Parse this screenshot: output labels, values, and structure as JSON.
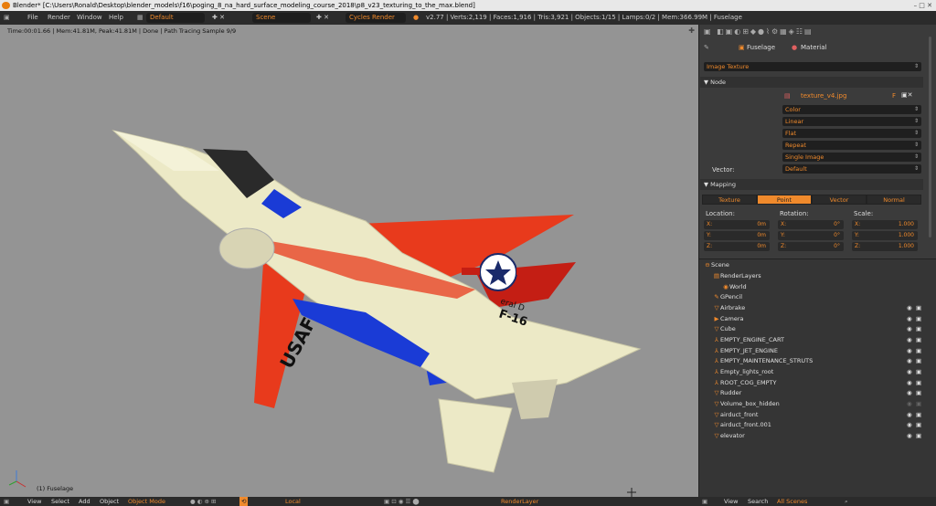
{
  "titlebar": {
    "title": "Blender* [C:\\Users\\Ronald\\Desktop\\blender_models\\f16\\poging_8_na_hard_surface_modeling_course_2018\\p8_v23_texturing_to_the_max.blend]",
    "controls": "–  □  ✕"
  },
  "infobar": {
    "menus": [
      "File",
      "Render",
      "Window",
      "Help"
    ],
    "layout": "Default",
    "scene": "Scene",
    "engine": "Cycles Render",
    "stats": "v2.77 | Verts:2,119 | Faces:1,916 | Tris:3,921 | Objects:1/15 | Lamps:0/2 | Mem:366.99M | Fuselage"
  },
  "viewport": {
    "status": "Time:00:01.66 | Mem:41.81M, Peak:41.81M | Done | Path Tracing Sample 9/9",
    "object_label": "(1) Fuselage",
    "jet_text": "USAF",
    "jet_text2": "F-16",
    "jet_text3": "eral D"
  },
  "viewbar": {
    "items": [
      "View",
      "Select",
      "Add",
      "Object"
    ],
    "mode": "Object Mode",
    "pivot": "Local",
    "layer": "RenderLayer"
  },
  "props": {
    "context1": "Fuselage",
    "context2": "Material",
    "node_type": "Image Texture",
    "node_section": "Node",
    "image_name": "texture_v4.jpg",
    "image_flag": "F",
    "dropdowns": [
      "Color",
      "Linear",
      "Flat",
      "Repeat",
      "Single Image"
    ],
    "vector_label": "Vector:",
    "vector_value": "Default",
    "mapping_section": "Mapping",
    "mapping_tabs": [
      "Texture",
      "Point",
      "Vector",
      "Normal"
    ],
    "location_label": "Location:",
    "rotation_label": "Rotation:",
    "scale_label": "Scale:",
    "loc": [
      {
        "axis": "X:",
        "val": "0m"
      },
      {
        "axis": "Y:",
        "val": "0m"
      },
      {
        "axis": "Z:",
        "val": "0m"
      }
    ],
    "rot": [
      {
        "axis": "X:",
        "val": "0°"
      },
      {
        "axis": "Y:",
        "val": "0°"
      },
      {
        "axis": "Z:",
        "val": "0°"
      }
    ],
    "scale": [
      {
        "axis": "X:",
        "val": "1.000"
      },
      {
        "axis": "Y:",
        "val": "1.000"
      },
      {
        "axis": "Z:",
        "val": "1.000"
      }
    ]
  },
  "outliner": {
    "rows": [
      "Scene",
      "RenderLayers",
      "World",
      "GPencil",
      "Airbrake",
      "Camera",
      "Cube",
      "EMPTY_ENGINE_CART",
      "EMPTY_JET_ENGINE",
      "EMPTY_MAINTENANCE_STRUTS",
      "Empty_lights_root",
      "ROOT_COG_EMPTY",
      "Rudder",
      "Volume_box_hidden",
      "airduct_front",
      "airduct_front.001",
      "elevator"
    ],
    "bar": [
      "View",
      "Search",
      "All Scenes"
    ]
  },
  "colors": {
    "accent": "#f08a2c",
    "jet_red": "#e83a1c",
    "jet_blue": "#1a3bd6",
    "jet_body": "#ece9c6"
  }
}
